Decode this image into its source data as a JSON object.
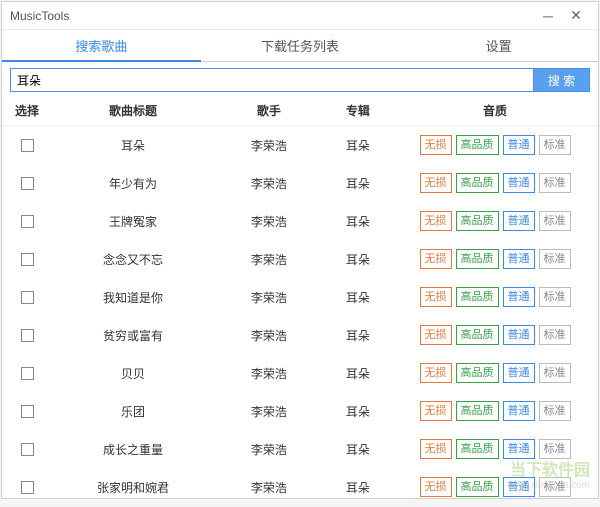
{
  "window": {
    "title": "MusicTools"
  },
  "tabs": {
    "search": "搜索歌曲",
    "downloads": "下载任务列表",
    "settings": "设置"
  },
  "search": {
    "value": "耳朵",
    "button": "搜 索"
  },
  "columns": {
    "select": "选择",
    "title": "歌曲标题",
    "artist": "歌手",
    "album": "专辑",
    "quality": "音质"
  },
  "quality_labels": {
    "lossless": "无损",
    "high": "高品质",
    "normal": "普通",
    "standard": "标准"
  },
  "rows": [
    {
      "title": "耳朵",
      "artist": "李荣浩",
      "album": "耳朵"
    },
    {
      "title": "年少有为",
      "artist": "李荣浩",
      "album": "耳朵"
    },
    {
      "title": "王牌冤家",
      "artist": "李荣浩",
      "album": "耳朵"
    },
    {
      "title": "念念又不忘",
      "artist": "李荣浩",
      "album": "耳朵"
    },
    {
      "title": "我知道是你",
      "artist": "李荣浩",
      "album": "耳朵"
    },
    {
      "title": "贫穷或富有",
      "artist": "李荣浩",
      "album": "耳朵"
    },
    {
      "title": "贝贝",
      "artist": "李荣浩",
      "album": "耳朵"
    },
    {
      "title": "乐团",
      "artist": "李荣浩",
      "album": "耳朵"
    },
    {
      "title": "成长之重量",
      "artist": "李荣浩",
      "album": "耳朵"
    },
    {
      "title": "张家明和婉君",
      "artist": "李荣浩",
      "album": "耳朵"
    }
  ],
  "watermark": {
    "brand": "当下软件园",
    "url": "www.downxia.com"
  }
}
